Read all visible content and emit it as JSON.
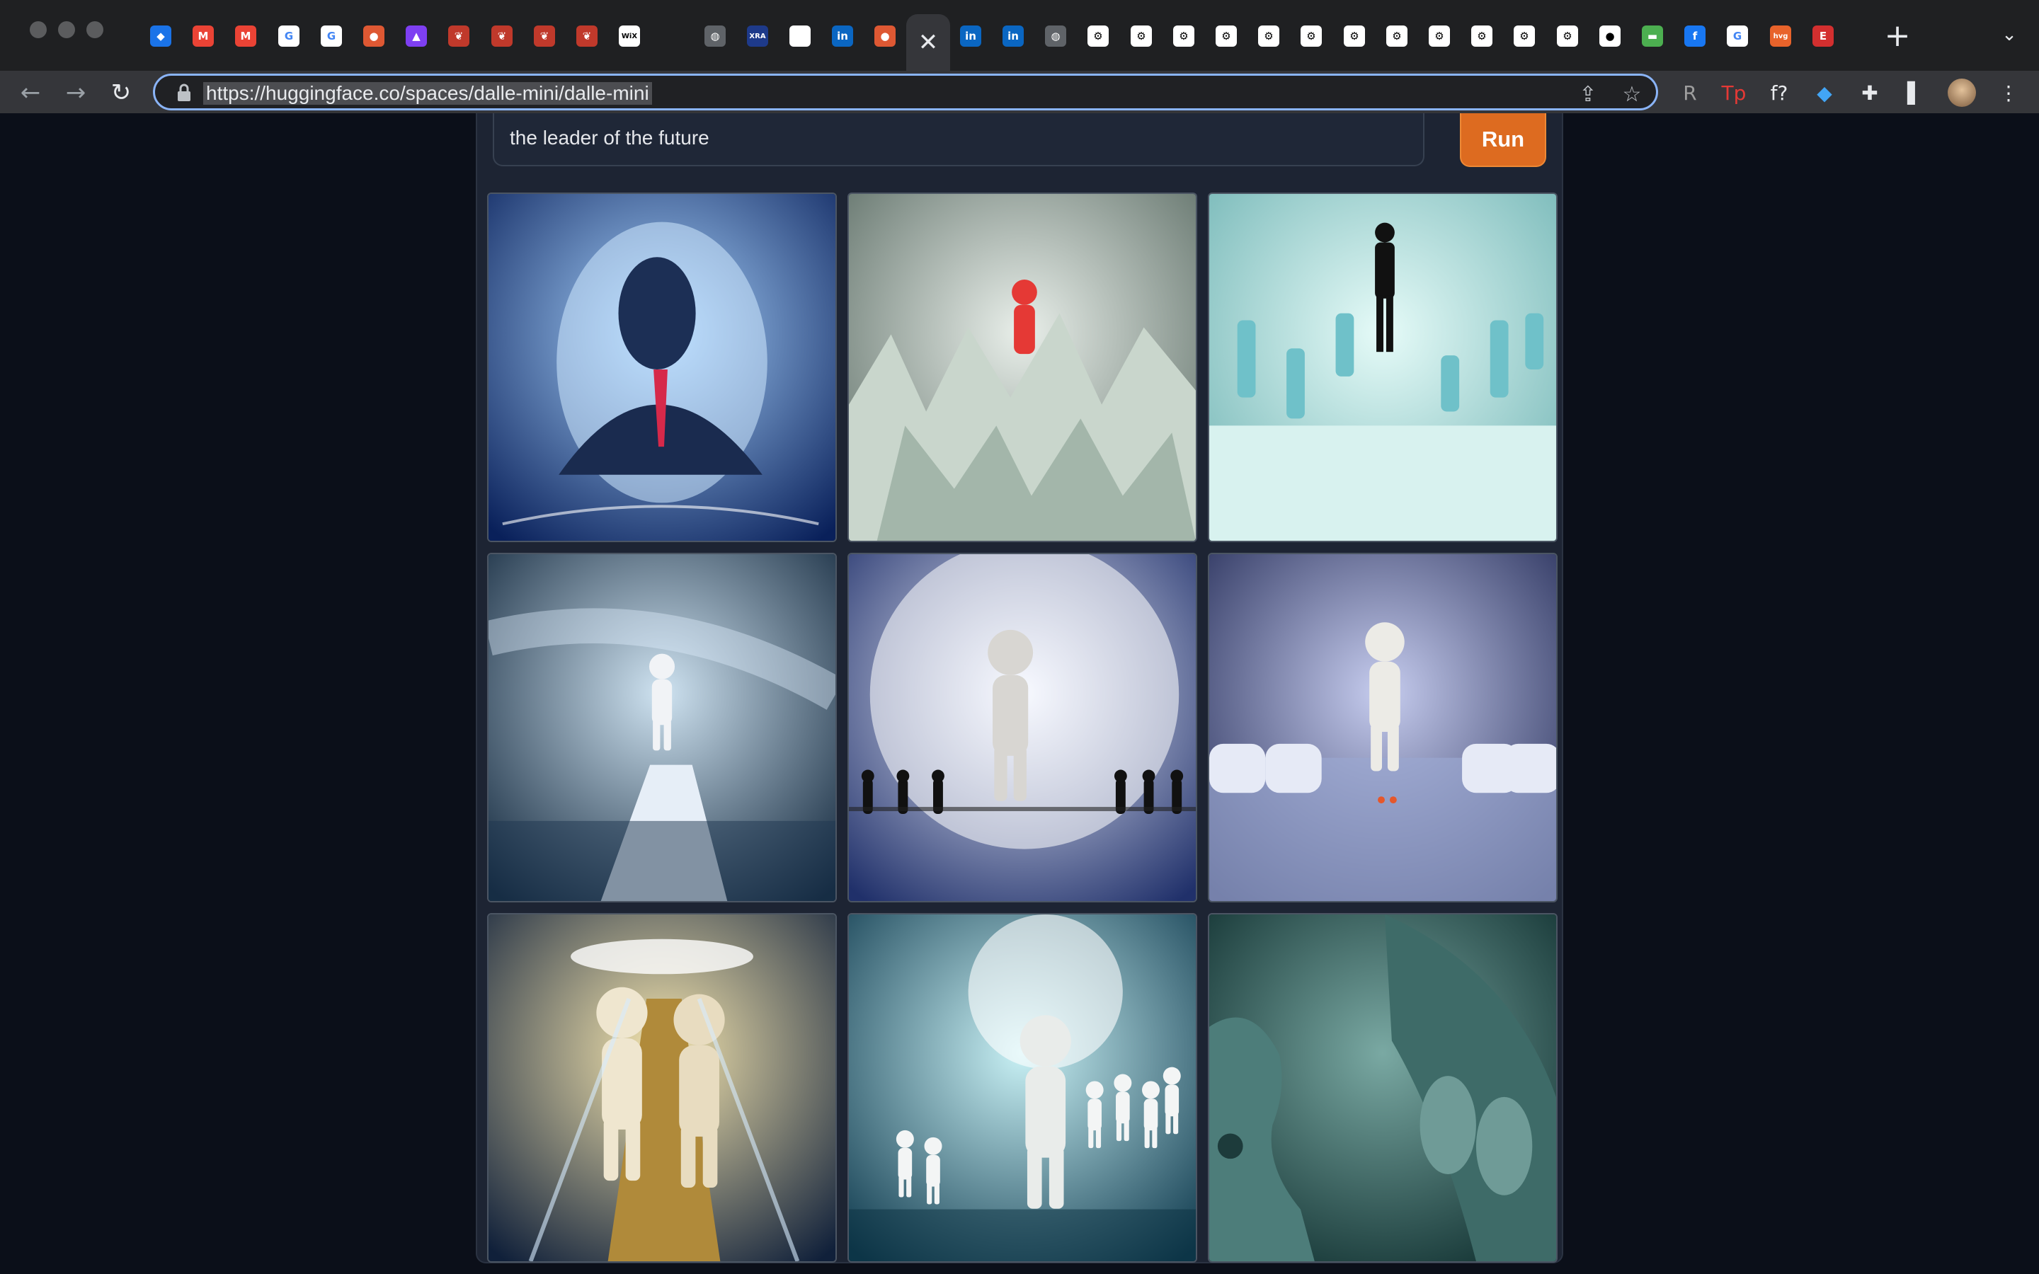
{
  "window": {
    "controls": [
      "close",
      "minimize",
      "zoom"
    ]
  },
  "tabs": [
    {
      "icon": "gem-icon",
      "glyph": "◆",
      "bg": "#1a73e8"
    },
    {
      "icon": "gmail-icon",
      "glyph": "M",
      "bg": "#ea4335"
    },
    {
      "icon": "gmail-icon",
      "glyph": "M",
      "bg": "#ea4335"
    },
    {
      "icon": "google-icon",
      "glyph": "G",
      "bg": "#ffffff",
      "fg": "#4285f4"
    },
    {
      "icon": "google-icon",
      "glyph": "G",
      "bg": "#ffffff",
      "fg": "#4285f4"
    },
    {
      "icon": "duckduckgo-icon",
      "glyph": "●",
      "bg": "#de5833"
    },
    {
      "icon": "purple-app-icon",
      "glyph": "▲",
      "bg": "#7e3ff2"
    },
    {
      "icon": "red-feather-icon",
      "glyph": "❦",
      "bg": "#c0392b"
    },
    {
      "icon": "red-feather-icon",
      "glyph": "❦",
      "bg": "#c0392b"
    },
    {
      "icon": "red-feather-icon",
      "glyph": "❦",
      "bg": "#c0392b"
    },
    {
      "icon": "red-feather-icon",
      "glyph": "❦",
      "bg": "#c0392b"
    },
    {
      "icon": "wix-icon",
      "glyph": "WiX",
      "bg": "#ffffff",
      "fg": "#000000"
    },
    {
      "icon": "blank-icon",
      "glyph": "",
      "bg": "transparent"
    },
    {
      "icon": "globe-icon",
      "glyph": "◍",
      "bg": "#5f6368"
    },
    {
      "icon": "xra-icon",
      "glyph": "XRA",
      "bg": "#1e3a8a"
    },
    {
      "icon": "white-square-icon",
      "glyph": "",
      "bg": "#ffffff"
    },
    {
      "icon": "linkedin-icon",
      "glyph": "in",
      "bg": "#0a66c2"
    },
    {
      "icon": "duckduckgo-icon",
      "glyph": "●",
      "bg": "#de5833"
    },
    {
      "icon": "close-icon",
      "glyph": "✕",
      "bg": "transparent",
      "active": true
    },
    {
      "icon": "linkedin-icon",
      "glyph": "in",
      "bg": "#0a66c2"
    },
    {
      "icon": "linkedin-icon",
      "glyph": "in",
      "bg": "#0a66c2"
    },
    {
      "icon": "globe-icon",
      "glyph": "◍",
      "bg": "#5f6368"
    },
    {
      "icon": "gear-icon",
      "glyph": "⚙",
      "bg": "#ffffff",
      "fg": "#000000"
    },
    {
      "icon": "gear-icon",
      "glyph": "⚙",
      "bg": "#ffffff",
      "fg": "#000000"
    },
    {
      "icon": "gear-icon",
      "glyph": "⚙",
      "bg": "#ffffff",
      "fg": "#000000"
    },
    {
      "icon": "gear-icon",
      "glyph": "⚙",
      "bg": "#ffffff",
      "fg": "#000000"
    },
    {
      "icon": "gear-icon",
      "glyph": "⚙",
      "bg": "#ffffff",
      "fg": "#000000"
    },
    {
      "icon": "gear-icon",
      "glyph": "⚙",
      "bg": "#ffffff",
      "fg": "#000000"
    },
    {
      "icon": "gear-icon",
      "glyph": "⚙",
      "bg": "#ffffff",
      "fg": "#000000"
    },
    {
      "icon": "gear-icon",
      "glyph": "⚙",
      "bg": "#ffffff",
      "fg": "#000000"
    },
    {
      "icon": "gear-icon",
      "glyph": "⚙",
      "bg": "#ffffff",
      "fg": "#000000"
    },
    {
      "icon": "gear-icon",
      "glyph": "⚙",
      "bg": "#ffffff",
      "fg": "#000000"
    },
    {
      "icon": "gear-icon",
      "glyph": "⚙",
      "bg": "#ffffff",
      "fg": "#000000"
    },
    {
      "icon": "gear-icon",
      "glyph": "⚙",
      "bg": "#ffffff",
      "fg": "#000000"
    },
    {
      "icon": "github-icon",
      "glyph": "●",
      "bg": "#ffffff",
      "fg": "#000000"
    },
    {
      "icon": "green-app-icon",
      "glyph": "▬",
      "bg": "#4caf50"
    },
    {
      "icon": "facebook-icon",
      "glyph": "f",
      "bg": "#1877f2"
    },
    {
      "icon": "google-icon",
      "glyph": "G",
      "bg": "#ffffff",
      "fg": "#4285f4"
    },
    {
      "icon": "hvg-icon",
      "glyph": "hvg",
      "bg": "#e8632b"
    },
    {
      "icon": "e-icon",
      "glyph": "E",
      "bg": "#d32f2f"
    }
  ],
  "address_bar": {
    "url": "https://huggingface.co/spaces/dalle-mini/dalle-mini"
  },
  "extensions": [
    {
      "icon": "r-extension-icon",
      "glyph": "R",
      "color": "#9e9e9e"
    },
    {
      "icon": "tp-extension-icon",
      "glyph": "Tp",
      "color": "#e53935"
    },
    {
      "icon": "font-extension-icon",
      "glyph": "f?",
      "color": "#e8eaed"
    },
    {
      "icon": "gem-extension-icon",
      "glyph": "◆",
      "color": "#42a5f5"
    },
    {
      "icon": "puzzle-icon",
      "glyph": "✚",
      "color": "#e8eaed"
    },
    {
      "icon": "side-panel-icon",
      "glyph": "▌",
      "color": "#e8eaed"
    }
  ],
  "app": {
    "prompt": "the leader of the future",
    "run_label": "Run"
  },
  "gallery": [
    {
      "scene": "silhouette",
      "c1": "#a9d4ff",
      "c2": "#09205a"
    },
    {
      "scene": "red-figure",
      "c1": "#e9efea",
      "c2": "#5a6b63"
    },
    {
      "scene": "suit-on-stage",
      "c1": "#e6fbf8",
      "c2": "#6fb3b3"
    },
    {
      "scene": "cliff-figure",
      "c1": "#cfe3f1",
      "c2": "#0f2439"
    },
    {
      "scene": "crowd-light",
      "c1": "#eef2ff",
      "c2": "#20306a"
    },
    {
      "scene": "figure-table",
      "c1": "#c7cdef",
      "c2": "#222a55"
    },
    {
      "scene": "two-figures",
      "c1": "#f7e7b0",
      "c2": "#10203a"
    },
    {
      "scene": "walking-crowd",
      "c1": "#c9f1f5",
      "c2": "#0f3a4e"
    },
    {
      "scene": "profile-face",
      "c1": "#7aa9a3",
      "c2": "#0d2c2c"
    }
  ]
}
